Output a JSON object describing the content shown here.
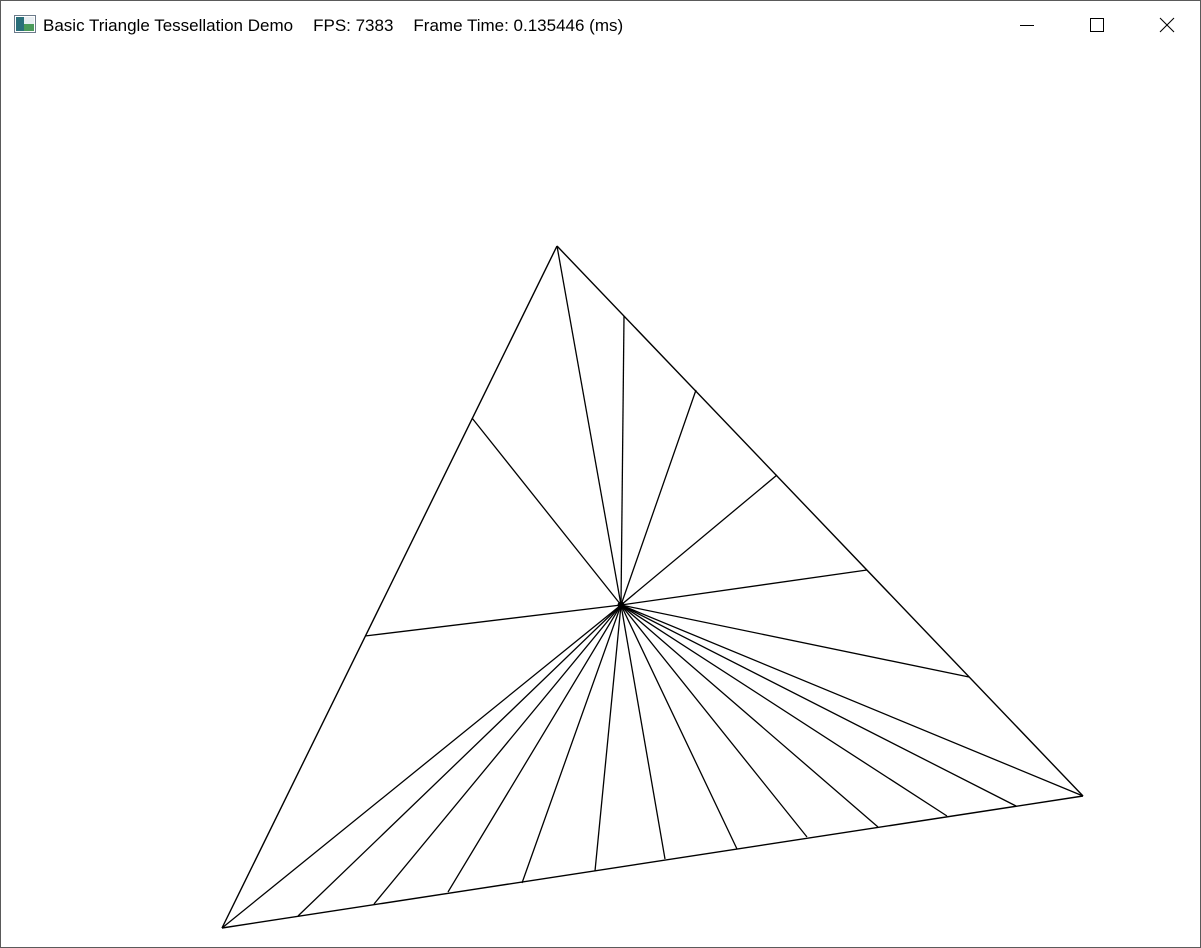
{
  "window": {
    "title": "Basic Triangle Tessellation Demo",
    "fps": "FPS: 7383",
    "frame_time": "Frame Time: 0.135446 (ms)",
    "controls": {
      "minimize_icon": "minimize-icon",
      "maximize_icon": "maximize-icon",
      "close_icon": "close-icon"
    }
  },
  "colors": {
    "background": "#ffffff",
    "wireframe": "#000000"
  }
}
